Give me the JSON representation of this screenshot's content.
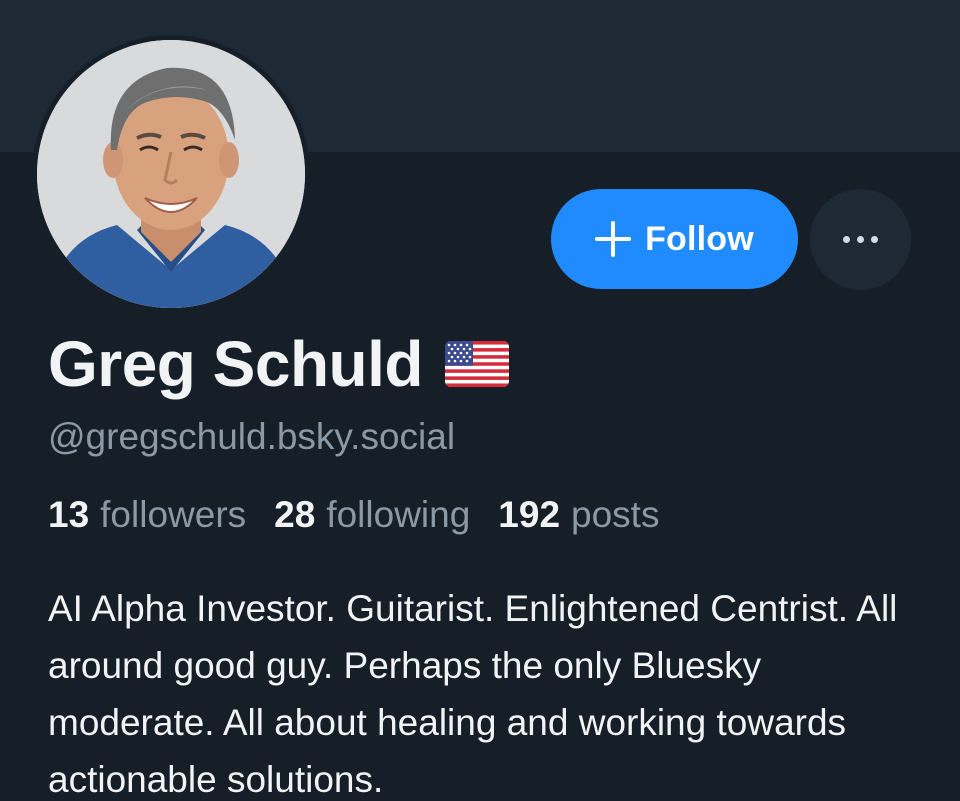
{
  "profile": {
    "display_name": "Greg Schuld",
    "flag": "🇺🇸",
    "handle": "@gregschuld.bsky.social",
    "bio": "AI Alpha Investor. Guitarist. Enlightened Centrist. All around good guy. Perhaps the only Bluesky moderate. All about healing and working towards actionable solutions."
  },
  "stats": {
    "followers_count": "13",
    "followers_label": "followers",
    "following_count": "28",
    "following_label": "following",
    "posts_count": "192",
    "posts_label": "posts"
  },
  "actions": {
    "follow_label": "Follow",
    "follow_icon": "plus-icon",
    "more_icon": "ellipsis-icon"
  },
  "colors": {
    "background": "#161e27",
    "banner": "#1e2936",
    "accent": "#208bfe",
    "text_primary": "#f1f3f5",
    "text_secondary": "#8b98a5"
  }
}
